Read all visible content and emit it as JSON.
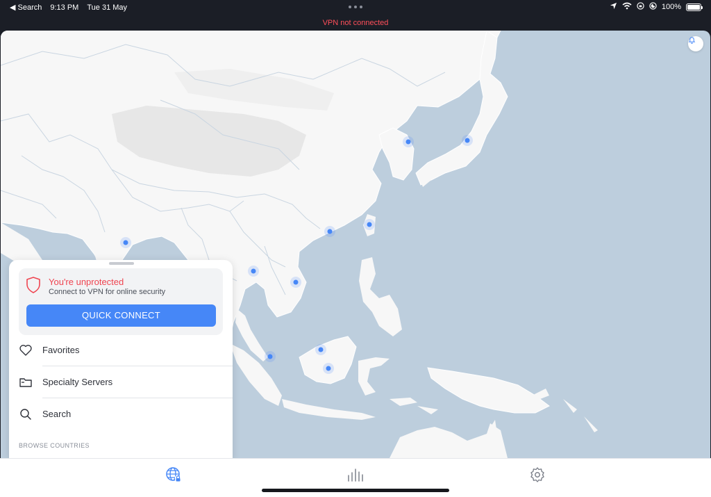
{
  "status_bar": {
    "back_label": "◀ Search",
    "time": "9:13 PM",
    "date": "Tue 31 May",
    "battery": "100%"
  },
  "vpn_banner": "VPN not connected",
  "protection_card": {
    "title": "You're unprotected",
    "subtitle": "Connect to VPN for online security",
    "quick_connect_label": "QUICK CONNECT"
  },
  "menu": {
    "items": [
      {
        "label": "Favorites",
        "icon": "heart-icon"
      },
      {
        "label": "Specialty Servers",
        "icon": "folder-icon"
      },
      {
        "label": "Search",
        "icon": "search-icon"
      }
    ]
  },
  "browse_header": "BROWSE COUNTRIES",
  "tab_bar": {
    "tabs": [
      {
        "name": "map",
        "icon": "globe-lock-icon",
        "active": true
      },
      {
        "name": "stats",
        "icon": "bar-chart-icon",
        "active": false
      },
      {
        "name": "settings",
        "icon": "gear-icon",
        "active": false
      }
    ]
  },
  "colors": {
    "accent": "#4687f7",
    "danger": "#ef4450",
    "sea": "#bdcedd",
    "land": "#f7f7f7",
    "land_inner": "#e7e7e7"
  }
}
